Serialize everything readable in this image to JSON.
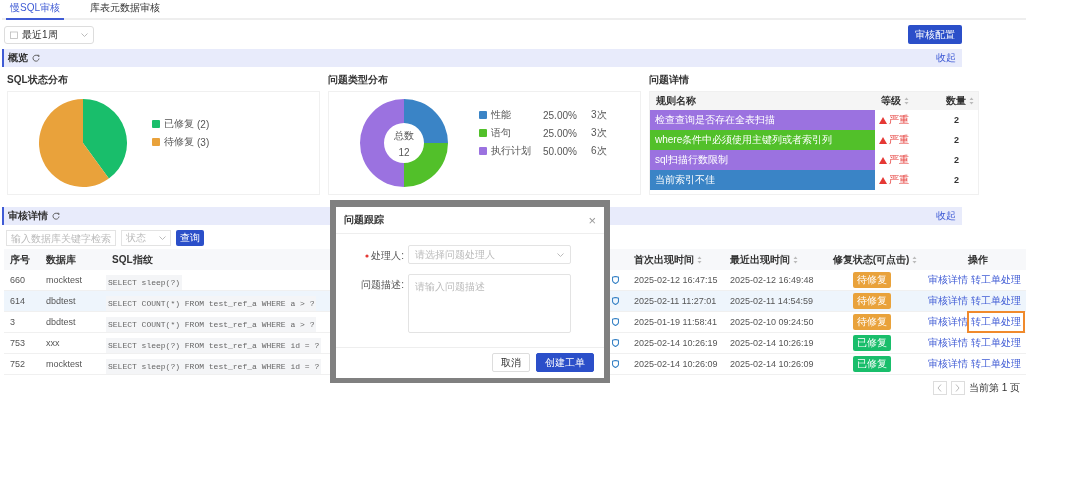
{
  "tabs": [
    {
      "label": "慢SQL审核",
      "selected": true
    },
    {
      "label": "库表元数据审核",
      "selected": false
    }
  ],
  "date_range": {
    "value": "最近1周"
  },
  "config_button": "审核配置",
  "overview": {
    "title": "概览",
    "collapse": "收起",
    "sql_status": {
      "title": "SQL状态分布",
      "counts": [
        "(2)",
        "(3)"
      ],
      "chart_data": {
        "type": "pie",
        "categories": [
          "已修复",
          "待修复"
        ],
        "values": [
          40,
          60
        ],
        "colors": [
          "#19be6b",
          "#e9a23b"
        ],
        "legend": "right"
      }
    },
    "issue_types": {
      "title": "问题类型分布",
      "center_label": "总数",
      "center_value": "12",
      "legend": [
        {
          "percent": "25.00%",
          "times": "3次"
        },
        {
          "percent": "25.00%",
          "times": "3次"
        },
        {
          "percent": "50.00%",
          "times": "6次"
        }
      ],
      "chart_data": {
        "type": "donut",
        "categories": [
          "性能",
          "语句",
          "执行计划"
        ],
        "values": [
          25,
          25,
          50
        ],
        "colors": [
          "#3a84c6",
          "#52c02a",
          "#9b72e0"
        ],
        "legend": "right"
      }
    },
    "issue_details": {
      "title": "问题详情",
      "columns": [
        "规则名称",
        "等级",
        "数量"
      ],
      "rows": [
        {
          "rule": "检查查询是否存在全表扫描",
          "level": "严重",
          "count": "2",
          "color": "#9b72e0"
        },
        {
          "rule": "where条件中必须使用主键列或者索引列",
          "level": "严重",
          "count": "2",
          "color": "#52c02a"
        },
        {
          "rule": "sql扫描行数限制",
          "level": "严重",
          "count": "2",
          "color": "#9b72e0"
        },
        {
          "rule": "当前索引不佳",
          "level": "严重",
          "count": "2",
          "color": "#3a84c6"
        }
      ]
    }
  },
  "audit": {
    "title": "审核详情",
    "collapse": "收起",
    "search": {
      "placeholder": "输入数据库关键字检索"
    },
    "status_filter": {
      "placeholder": "状态"
    },
    "query_button": "查询",
    "columns": [
      "序号",
      "数据库",
      "SQL指纹",
      "首次出现时间",
      "最近出现时间",
      "修复状态(可点击)",
      "操作"
    ],
    "rows": [
      {
        "id": "660",
        "db": "mocktest",
        "sql": "SELECT sleep(?)",
        "first": "2025-02-12 16:47:15",
        "last": "2025-02-12 16:49:48",
        "status": "待修复",
        "fixed": false,
        "hover": false,
        "actions": [
          {
            "label": "审核详情",
            "highlighted": false
          },
          {
            "label": "转工单处理",
            "highlighted": false
          }
        ]
      },
      {
        "id": "614",
        "db": "dbdtest",
        "sql": "SELECT COUNT(*) FROM test_ref_a WHERE a > ?",
        "first": "2025-02-11 11:27:01",
        "last": "2025-02-11 14:54:59",
        "status": "待修复",
        "fixed": false,
        "hover": true,
        "actions": [
          {
            "label": "审核详情",
            "highlighted": false
          },
          {
            "label": "转工单处理",
            "highlighted": false
          }
        ]
      },
      {
        "id": "3",
        "db": "dbdtest",
        "sql": "SELECT COUNT(*) FROM test_ref_a WHERE a > ?",
        "first": "2025-01-19 11:58:41",
        "last": "2025-02-10 09:24:50",
        "status": "待修复",
        "fixed": false,
        "hover": false,
        "actions": [
          {
            "label": "审核详情",
            "highlighted": false
          },
          {
            "label": "转工单处理",
            "highlighted": true
          }
        ]
      },
      {
        "id": "753",
        "db": "xxx",
        "sql": "SELECT sleep(?) FROM test_ref_a WHERE id = ?",
        "first": "2025-02-14 10:26:19",
        "last": "2025-02-14 10:26:19",
        "status": "已修复",
        "fixed": true,
        "hover": false,
        "actions": [
          {
            "label": "审核详情",
            "highlighted": false
          },
          {
            "label": "转工单处理",
            "highlighted": false
          }
        ]
      },
      {
        "id": "752",
        "db": "mocktest",
        "sql": "SELECT sleep(?) FROM test_ref_a WHERE id = ?",
        "first": "2025-02-14 10:26:09",
        "last": "2025-02-14 10:26:09",
        "status": "已修复",
        "fixed": true,
        "hover": false,
        "actions": [
          {
            "label": "审核详情",
            "highlighted": false
          },
          {
            "label": "转工单处理",
            "highlighted": false
          }
        ]
      }
    ],
    "pagination": {
      "label": "当前第 1 页"
    }
  },
  "dialog": {
    "title": "问题跟踪",
    "close": "×",
    "fields": [
      {
        "label": "处理人:",
        "required": true,
        "kind": "select",
        "placeholder": "请选择问题处理人"
      },
      {
        "label": "问题描述:",
        "required": false,
        "kind": "textarea",
        "placeholder": "请输入问题描述"
      }
    ],
    "buttons": [
      {
        "label": "取消",
        "primary": false
      },
      {
        "label": "创建工单",
        "primary": true
      }
    ]
  }
}
